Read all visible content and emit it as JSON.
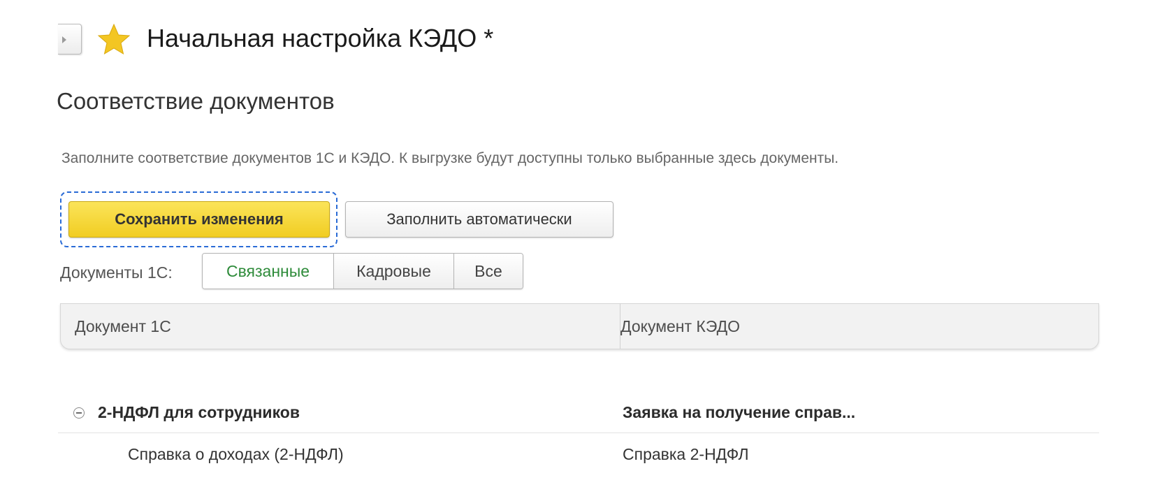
{
  "header": {
    "title": "Начальная настройка КЭДО *",
    "favorite_icon": "star-icon",
    "favorite_color": "#f3c623"
  },
  "section": {
    "title": "Соответствие документов",
    "hint": "Заполните соответствие документов 1С и КЭДО. К выгрузке будут доступны только выбранные здесь документы."
  },
  "toolbar": {
    "save_label": "Сохранить изменения",
    "autofill_label": "Заполнить автоматически"
  },
  "filter": {
    "label": "Документы 1С:",
    "options": [
      "Связанные",
      "Кадровые",
      "Все"
    ],
    "selected": "Связанные"
  },
  "table": {
    "columns": [
      "Документ 1С",
      "Документ КЭДО"
    ],
    "rows": [
      {
        "type": "group",
        "doc_1c": "2-НДФЛ для сотрудников",
        "doc_kedo": "Заявка на получение справ..."
      },
      {
        "type": "item",
        "doc_1c": "Справка о доходах (2-НДФЛ)",
        "doc_kedo": "Справка 2-НДФЛ"
      }
    ]
  },
  "colors": {
    "accent_button": "#f1cd22",
    "active_filter_text": "#2e8b3a",
    "focus_outline": "#2a6bd6"
  }
}
